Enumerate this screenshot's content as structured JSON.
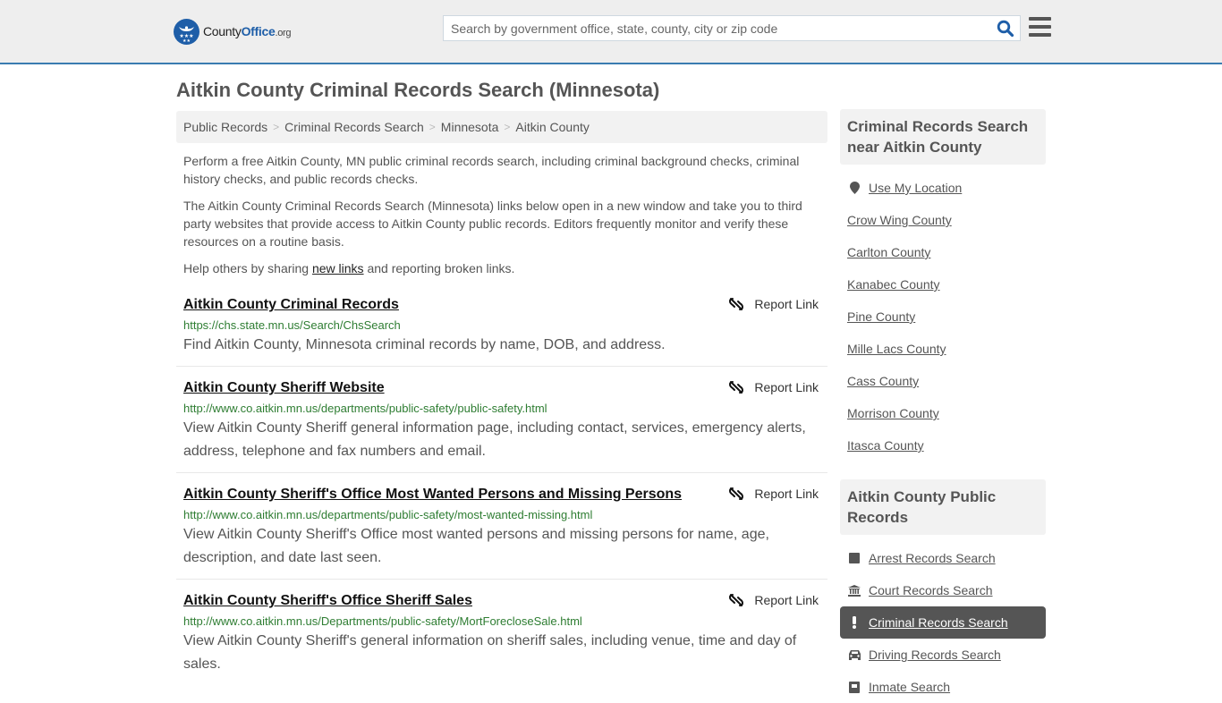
{
  "header": {
    "logo": {
      "text_main": "County",
      "text_accent": "Office",
      "text_suffix": ".org",
      "icon": "eagle-stars-badge"
    },
    "search": {
      "placeholder": "Search by government office, state, county, city or zip code",
      "value": "",
      "icon": "search-icon"
    },
    "menu_icon": "hamburger-menu-icon"
  },
  "page": {
    "title": "Aitkin County Criminal Records Search (Minnesota)",
    "breadcrumb": [
      "Public Records",
      "Criminal Records Search",
      "Minnesota",
      "Aitkin County"
    ],
    "intro": {
      "p1": "Perform a free Aitkin County, MN public criminal records search, including criminal background checks, criminal history checks, and public records checks.",
      "p2": "The Aitkin County Criminal Records Search (Minnesota) links below open in a new window and take you to third party websites that provide access to Aitkin County public records. Editors frequently monitor and verify these resources on a routine basis.",
      "p3_before": "Help others by sharing ",
      "p3_link": "new links",
      "p3_after": " and reporting broken links."
    },
    "report_label": "Report Link",
    "results": [
      {
        "title": "Aitkin County Criminal Records",
        "url": "https://chs.state.mn.us/Search/ChsSearch",
        "description": "Find Aitkin County, Minnesota criminal records by name, DOB, and address."
      },
      {
        "title": "Aitkin County Sheriff Website",
        "url": "http://www.co.aitkin.mn.us/departments/public-safety/public-safety.html",
        "description": "View Aitkin County Sheriff general information page, including contact, services, emergency alerts, address, telephone and fax numbers and email."
      },
      {
        "title": "Aitkin County Sheriff's Office Most Wanted Persons and Missing Persons",
        "url": "http://www.co.aitkin.mn.us/departments/public-safety/most-wanted-missing.html",
        "description": "View Aitkin County Sheriff's Office most wanted persons and missing persons for name, age, description, and date last seen."
      },
      {
        "title": "Aitkin County Sheriff's Office Sheriff Sales",
        "url": "http://www.co.aitkin.mn.us/Departments/public-safety/MortForecloseSale.html",
        "description": "View Aitkin County Sheriff's general information on sheriff sales, including venue, time and day of sales."
      }
    ]
  },
  "sidebar": {
    "nearby": {
      "heading": "Criminal Records Search near Aitkin County",
      "use_location": "Use My Location",
      "counties": [
        "Crow Wing County",
        "Carlton County",
        "Kanabec County",
        "Pine County",
        "Mille Lacs County",
        "Cass County",
        "Morrison County",
        "Itasca County"
      ]
    },
    "public_records": {
      "heading": "Aitkin County Public Records",
      "items": [
        {
          "label": "Arrest Records Search",
          "icon": "square-icon",
          "active": false
        },
        {
          "label": "Court Records Search",
          "icon": "courthouse-icon",
          "active": false
        },
        {
          "label": "Criminal Records Search",
          "icon": "exclamation-icon",
          "active": true
        },
        {
          "label": "Driving Records Search",
          "icon": "car-icon",
          "active": false
        },
        {
          "label": "Inmate Search",
          "icon": "jail-icon",
          "active": false
        }
      ]
    }
  },
  "colors": {
    "header_bg": "#eeeeee",
    "header_border": "#3a7cb0",
    "brand_blue": "#1e5ea8",
    "url_green": "#2e7d32",
    "active_item_bg": "#555555"
  }
}
